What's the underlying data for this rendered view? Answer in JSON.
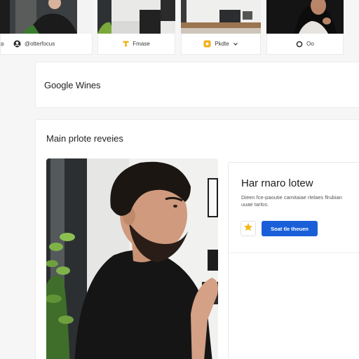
{
  "chips": [
    {
      "label": "@otterfocus",
      "icon": "avatar-dot-icon"
    },
    {
      "label": "Fmase",
      "icon": "pin-icon"
    },
    {
      "label": "Pkdte",
      "icon": "yellow-badge-icon"
    },
    {
      "label": "Oo",
      "icon": "ring-icon"
    }
  ],
  "header": {
    "title": "Google Wines"
  },
  "main": {
    "section_title": "Main prlote reveies",
    "review": {
      "title": "Har rnaro lotew",
      "description": "Dieen fce-paoutie camitaiae rlelaes flrubian uuae tarlos.",
      "button_label": "Soat tle theuen",
      "star_icon": "star-icon"
    }
  },
  "colors": {
    "accent": "#1a5fd8",
    "star": "#f5b915",
    "pin": "#f3b21b"
  }
}
